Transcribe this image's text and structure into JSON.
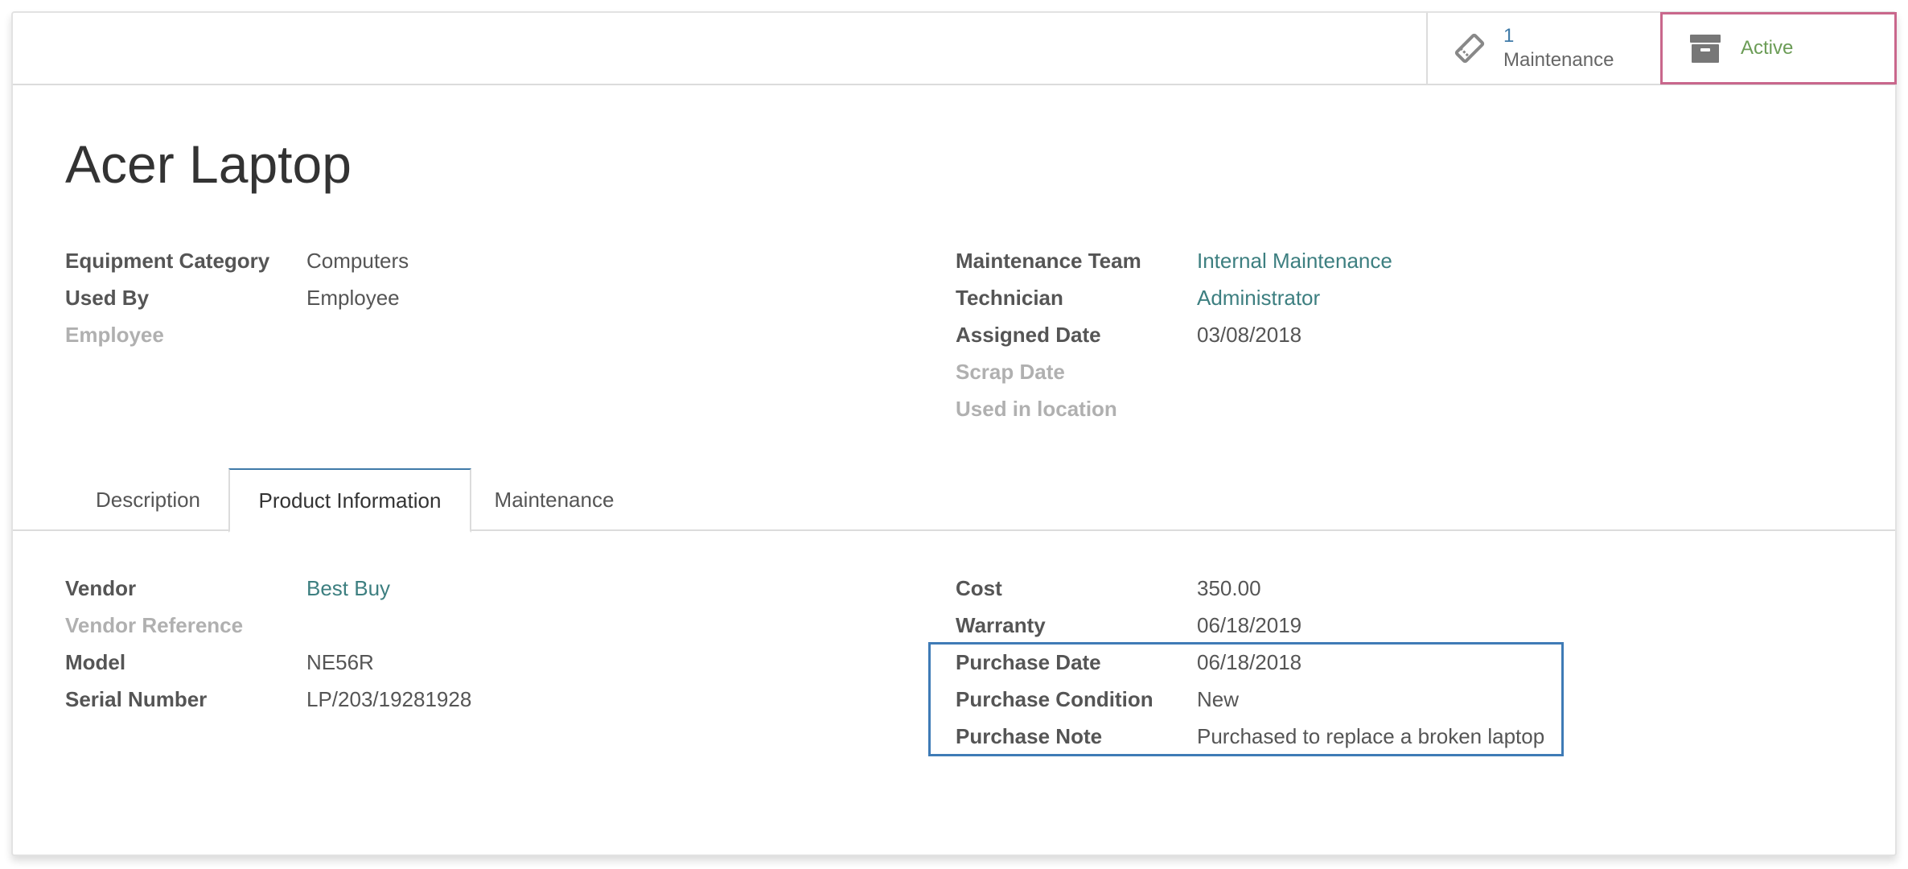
{
  "stat_buttons": {
    "maintenance": {
      "count": "1",
      "label": "Maintenance",
      "icon": "ticket-icon"
    },
    "active": {
      "label": "Active",
      "icon": "archive-icon"
    }
  },
  "title": "Acer Laptop",
  "header_left": [
    {
      "label": "Equipment Category",
      "value": "Computers",
      "muted": false,
      "link": false
    },
    {
      "label": "Used By",
      "value": "Employee",
      "muted": false,
      "link": false
    },
    {
      "label": "Employee",
      "value": "",
      "muted": true,
      "link": false
    }
  ],
  "header_right": [
    {
      "label": "Maintenance Team",
      "value": "Internal Maintenance",
      "muted": false,
      "link": true
    },
    {
      "label": "Technician",
      "value": "Administrator",
      "muted": false,
      "link": true
    },
    {
      "label": "Assigned Date",
      "value": "03/08/2018",
      "muted": false,
      "link": false
    },
    {
      "label": "Scrap Date",
      "value": "",
      "muted": true,
      "link": false
    },
    {
      "label": "Used in location",
      "value": "",
      "muted": true,
      "link": false
    }
  ],
  "tabs": [
    {
      "label": "Description"
    },
    {
      "label": "Product Information"
    },
    {
      "label": "Maintenance"
    }
  ],
  "product_left": [
    {
      "label": "Vendor",
      "value": "Best Buy",
      "muted": false,
      "link": true
    },
    {
      "label": "Vendor Reference",
      "value": "",
      "muted": true,
      "link": false
    },
    {
      "label": "Model",
      "value": "NE56R",
      "muted": false,
      "link": false
    },
    {
      "label": "Serial Number",
      "value": "LP/203/19281928",
      "muted": false,
      "link": false
    }
  ],
  "product_right": [
    {
      "label": "Cost",
      "value": "350.00",
      "muted": false,
      "link": false
    },
    {
      "label": "Warranty",
      "value": "06/18/2019",
      "muted": false,
      "link": false
    },
    {
      "label": "Purchase Date",
      "value": "06/18/2018",
      "muted": false,
      "link": false
    },
    {
      "label": "Purchase Condition",
      "value": "New",
      "muted": false,
      "link": false
    },
    {
      "label": "Purchase Note",
      "value": "Purchased to replace a broken laptop",
      "muted": false,
      "link": false
    }
  ],
  "colors": {
    "link": "#3d7f80",
    "stat_number": "#3f7aa8",
    "active": "#6b9c56",
    "highlight_active": "#c9678c",
    "highlight_purchase": "#3f7bb6"
  }
}
